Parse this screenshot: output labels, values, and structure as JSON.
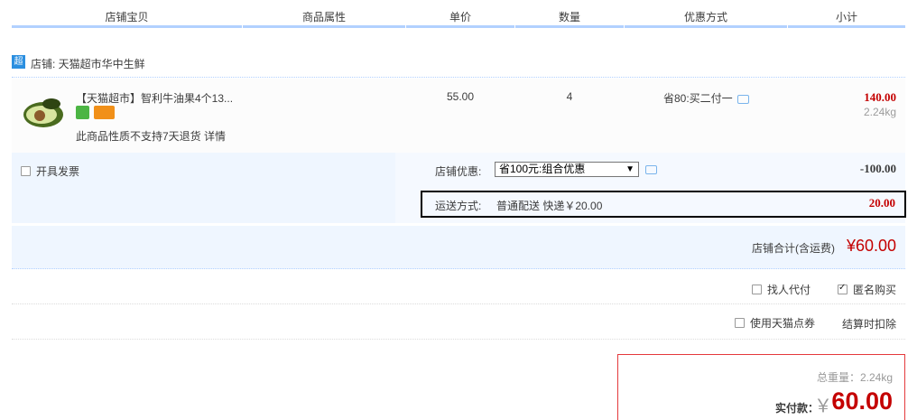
{
  "header": {
    "col_shop_item": "店铺宝贝",
    "col_attributes": "商品属性",
    "col_unit_price": "单价",
    "col_quantity": "数量",
    "col_discount": "优惠方式",
    "col_subtotal": "小计"
  },
  "shop": {
    "badge": "超",
    "label": "店铺: 天猫超市华中生鲜"
  },
  "item": {
    "title": "【天猫超市】智利牛油果4个13...",
    "note": "此商品性质不支持7天退货 详情",
    "price": "55.00",
    "quantity": "4",
    "promo": "省80:买二付一",
    "total": "140.00",
    "weight": "2.24kg",
    "icons": [
      "service-icon",
      "card-icon",
      "chat-icon"
    ]
  },
  "options": {
    "invoice_label": "开具发票",
    "shop_discount_label": "店铺优惠:",
    "shop_discount_selected": "省100元:组合优惠",
    "shop_discount_amount": "-100.00",
    "shipping_label": "运送方式:",
    "shipping_value": "普通配送 快递￥20.00",
    "shipping_amount": "20.00"
  },
  "subtotal": {
    "label": "店铺合计(含运费)",
    "value": "¥60.00"
  },
  "extras": {
    "pay_for_label": "找人代付",
    "anonymous_label": "匿名购买",
    "anonymous_checked": true,
    "points_label": "使用天猫点券",
    "deduct_label": "结算时扣除"
  },
  "summary": {
    "weight_total": "总重量：2.24kg",
    "pay_label": "实付款：",
    "currency": "￥",
    "pay_value": "60.00"
  },
  "colors": {
    "accent_red": "#c40000",
    "header_line": "#b2d1ff",
    "panel_bg": "#eff6ff"
  }
}
